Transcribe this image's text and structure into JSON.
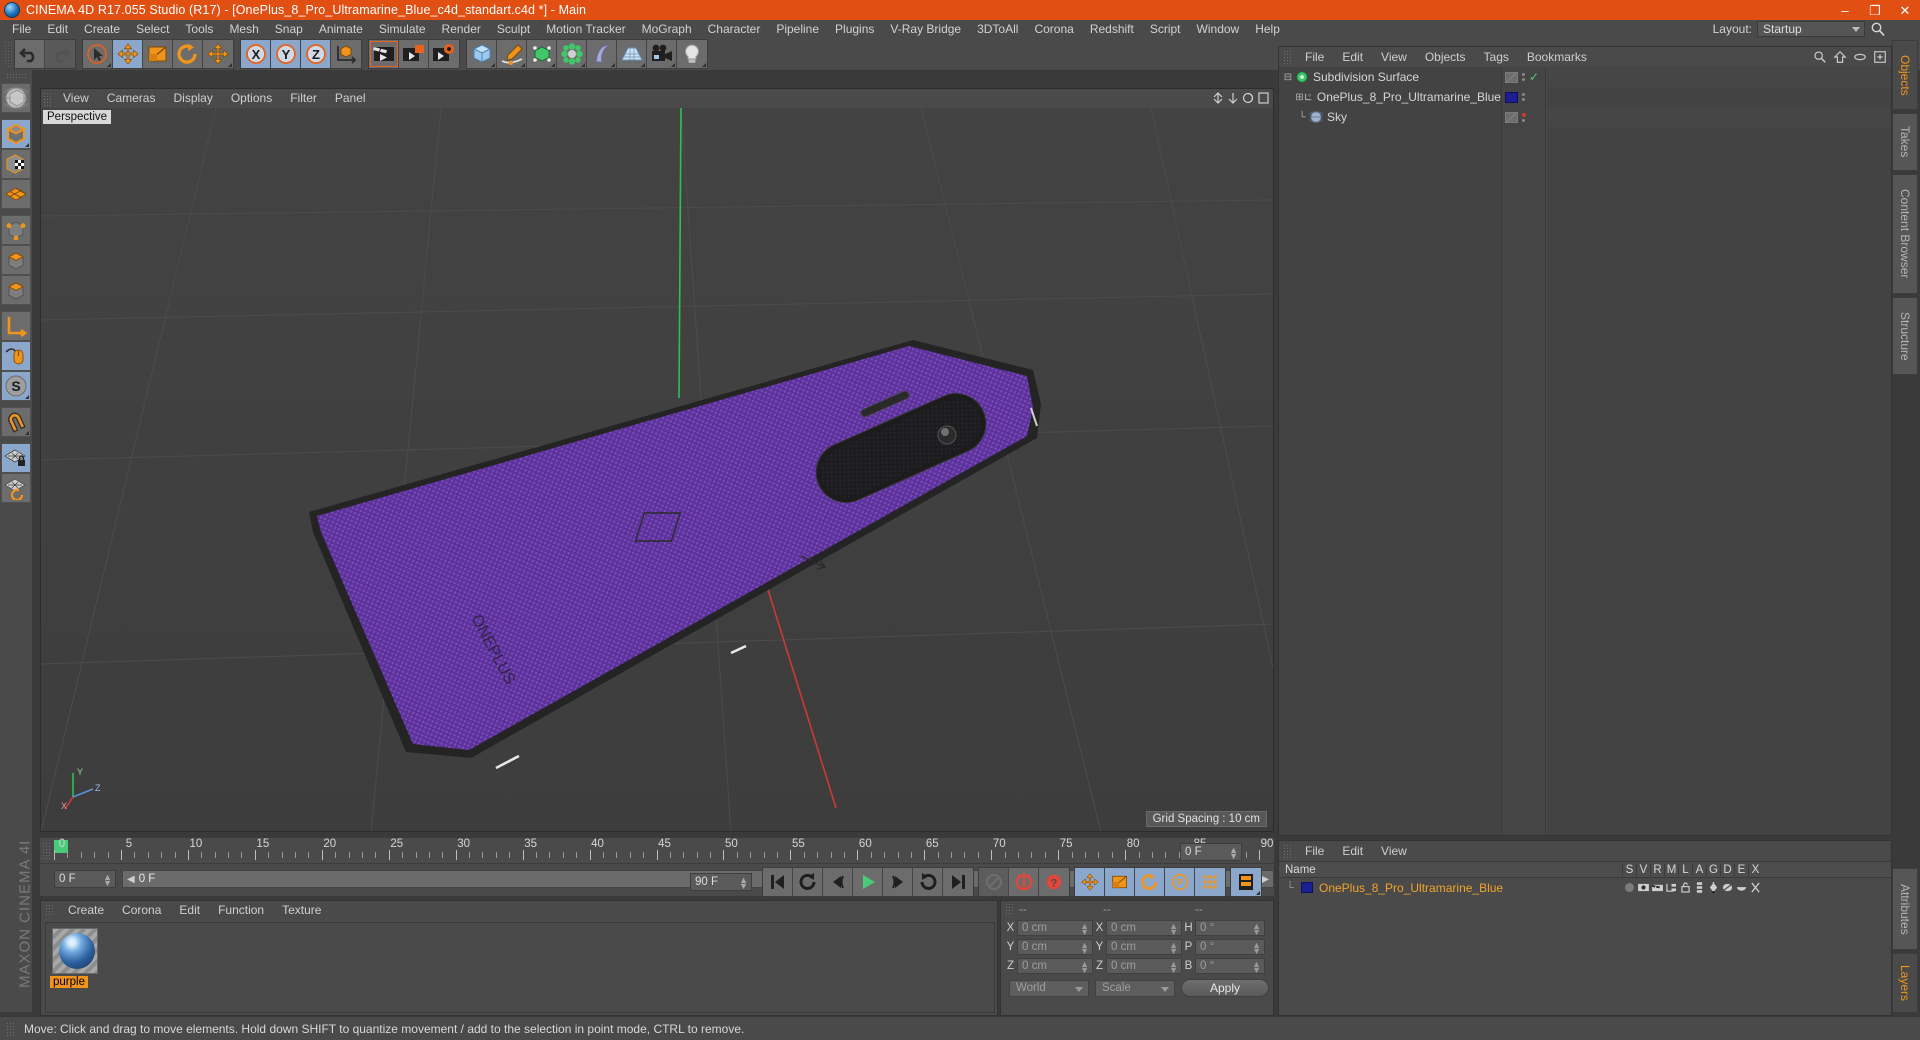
{
  "window": {
    "title": "CINEMA 4D R17.055 Studio (R17) - [OnePlus_8_Pro_Ultramarine_Blue_c4d_standart.c4d *] - Main",
    "app_icon": "cinema4d-logo-icon",
    "minimize": "–",
    "maximize": "❐",
    "close": "✕",
    "titlebar_color": "#e14f13"
  },
  "menubar": {
    "items": [
      "File",
      "Edit",
      "Create",
      "Select",
      "Tools",
      "Mesh",
      "Snap",
      "Animate",
      "Simulate",
      "Render",
      "Sculpt",
      "Motion Tracker",
      "MoGraph",
      "Character",
      "Pipeline",
      "Plugins",
      "V-Ray Bridge",
      "3DToAll",
      "Corona",
      "Redshift",
      "Script",
      "Window",
      "Help"
    ],
    "layout_label": "Layout:",
    "layout_value": "Startup",
    "search_icon": "search-icon"
  },
  "toolbar": {
    "groups": [
      {
        "name": "undo-redo",
        "buttons": [
          {
            "icon": "undo-icon",
            "active": false
          },
          {
            "icon": "redo-icon",
            "active": false
          }
        ]
      },
      {
        "name": "tools",
        "buttons": [
          {
            "icon": "live-selection-icon",
            "active": false
          },
          {
            "icon": "move-icon",
            "active": true
          },
          {
            "icon": "scale-icon",
            "active": false
          },
          {
            "icon": "rotate-icon",
            "active": false
          },
          {
            "icon": "move-duplicate-icon",
            "active": false
          }
        ]
      },
      {
        "name": "axis-locks",
        "buttons": [
          {
            "icon": "x-axis-icon",
            "active": true
          },
          {
            "icon": "y-axis-icon",
            "active": true
          },
          {
            "icon": "z-axis-icon",
            "active": true
          },
          {
            "icon": "world-object-coordinate-icon",
            "active": false
          }
        ]
      },
      {
        "name": "render",
        "buttons": [
          {
            "icon": "render-view-icon",
            "active": false
          },
          {
            "icon": "render-to-picture-viewer-icon",
            "active": false
          },
          {
            "icon": "render-settings-icon",
            "active": false
          }
        ]
      },
      {
        "name": "objects",
        "buttons": [
          {
            "icon": "cube-primitive-icon",
            "active": false
          },
          {
            "icon": "spline-pen-icon",
            "active": false
          },
          {
            "icon": "nurbs-icon",
            "active": false
          },
          {
            "icon": "array-icon",
            "active": false
          },
          {
            "icon": "bend-deformer-icon",
            "active": false
          },
          {
            "icon": "floor-environment-icon",
            "active": false
          },
          {
            "icon": "camera-icon",
            "active": false
          },
          {
            "icon": "light-icon",
            "active": false
          }
        ]
      }
    ]
  },
  "left_toolbar": {
    "buttons": [
      {
        "icon": "make-editable-icon",
        "active": false
      },
      {
        "icon": "model-mode-icon",
        "active": true
      },
      {
        "icon": "texture-mode-icon",
        "active": false
      },
      {
        "icon": "polygon-grid-icon",
        "active": false
      },
      {
        "icon": "point-mode-icon",
        "active": false
      },
      {
        "icon": "edge-mode-icon",
        "active": false
      },
      {
        "icon": "polygon-mode-icon",
        "active": false
      },
      {
        "icon": "axis-modification-icon",
        "active": false
      },
      {
        "icon": "enable-snapping-icon",
        "active": true
      },
      {
        "icon": "workplane-icon",
        "active": true
      },
      {
        "icon": "magnet-icon",
        "active": false
      },
      {
        "icon": "lock-workplane-icon",
        "active": true
      },
      {
        "icon": "workplane-rotate-icon",
        "active": false
      }
    ],
    "brand_text": "MAXON CINEMA 4D"
  },
  "viewport": {
    "menu": [
      "View",
      "Cameras",
      "Display",
      "Options",
      "Filter",
      "Panel"
    ],
    "label": "Perspective",
    "grid_spacing": "Grid Spacing : 10 cm",
    "axis_labels": {
      "x": "X",
      "y": "Y",
      "z": "Z"
    },
    "object_color": "#6b3fb0",
    "nav_icons": [
      "pan-icon",
      "zoom-icon",
      "rotate-icon",
      "maximize-view-icon"
    ]
  },
  "timeline": {
    "ticks": [
      0,
      5,
      10,
      15,
      20,
      25,
      30,
      35,
      40,
      45,
      50,
      55,
      60,
      65,
      70,
      75,
      80,
      85,
      90
    ],
    "current_frame": "0 F",
    "start_frame": "0 F",
    "end_frame": "90 F",
    "preview_min": "0 F",
    "preview_max": "90 F",
    "playhead_frame": 0
  },
  "transport": {
    "buttons": [
      {
        "icon": "go-to-start-icon"
      },
      {
        "icon": "previous-key-icon"
      },
      {
        "icon": "step-back-icon"
      },
      {
        "icon": "play-icon"
      },
      {
        "icon": "step-forward-icon"
      },
      {
        "icon": "next-key-icon"
      },
      {
        "icon": "go-to-end-icon"
      },
      {
        "icon": "record-active-objects-icon"
      },
      {
        "icon": "autokeying-icon"
      },
      {
        "icon": "keyframe-selection-icon"
      },
      {
        "icon": "record-position-icon"
      },
      {
        "icon": "record-scale-icon"
      },
      {
        "icon": "record-rotation-icon"
      },
      {
        "icon": "record-parameter-icon"
      },
      {
        "icon": "point-level-animation-icon"
      },
      {
        "icon": "timeline-icon"
      }
    ]
  },
  "material_manager": {
    "menu": [
      "Create",
      "Corona",
      "Edit",
      "Function",
      "Texture"
    ],
    "materials": [
      {
        "name": "purple",
        "selected": true
      }
    ]
  },
  "coordinates": {
    "headers": [
      "--",
      "--",
      "--"
    ],
    "rows": [
      {
        "label1": "X",
        "v1": "0 cm",
        "label2": "X",
        "v2": "0 cm",
        "label3": "H",
        "v3": "0 °"
      },
      {
        "label1": "Y",
        "v1": "0 cm",
        "label2": "Y",
        "v2": "0 cm",
        "label3": "P",
        "v3": "0 °"
      },
      {
        "label1": "Z",
        "v1": "0 cm",
        "label2": "Z",
        "v2": "0 cm",
        "label3": "B",
        "v3": "0 °"
      }
    ],
    "system": "World",
    "mode": "Scale",
    "apply": "Apply"
  },
  "object_manager": {
    "menu": [
      "File",
      "Edit",
      "View",
      "Objects",
      "Tags",
      "Bookmarks"
    ],
    "header_icons": [
      "search-icon",
      "home-icon",
      "ellipse-icon",
      "add-layer-icon"
    ],
    "items": [
      {
        "name": "Subdivision Surface",
        "icon": "subdivision-surface-icon",
        "indent": 0,
        "expander": "minus",
        "tag_color": "#7a7a7a",
        "dot_color": "#8a8a8a",
        "check": "✓",
        "check_color": "#4fc972",
        "selected": false
      },
      {
        "name": "OnePlus_8_Pro_Ultramarine_Blue",
        "icon": "null-object-icon",
        "indent": 1,
        "expander": "plus",
        "tag_color": "#1b1f8f",
        "dot_color": "#8a8a8a",
        "check": "",
        "check_color": "",
        "selected": false
      },
      {
        "name": "Sky",
        "icon": "sky-object-icon",
        "indent": 1,
        "expander": "none",
        "tag_color": "#7a7a7a",
        "dot_color": "#d03a2a",
        "check": "",
        "check_color": "",
        "selected": false
      }
    ]
  },
  "attribute_manager": {
    "menu": [
      "File",
      "Edit",
      "View"
    ],
    "columns": [
      "Name",
      "S",
      "V",
      "R",
      "M",
      "L",
      "A",
      "G",
      "D",
      "E",
      "X"
    ],
    "rows": [
      {
        "name": "OnePlus_8_Pro_Ultramarine_Blue",
        "color": "#1b1f8f",
        "selected": true
      }
    ]
  },
  "right_tabs_top": [
    {
      "label": "Objects",
      "active": true
    },
    {
      "label": "Takes",
      "active": false
    },
    {
      "label": "Content Browser",
      "active": false
    },
    {
      "label": "Structure",
      "active": false
    }
  ],
  "right_tabs_bottom": [
    {
      "label": "Attributes",
      "active": false
    },
    {
      "label": "Layers",
      "active": true
    }
  ],
  "statusbar": {
    "text": "Move: Click and drag to move elements. Hold down SHIFT to quantize movement / add to the selection in point mode, CTRL to remove."
  }
}
